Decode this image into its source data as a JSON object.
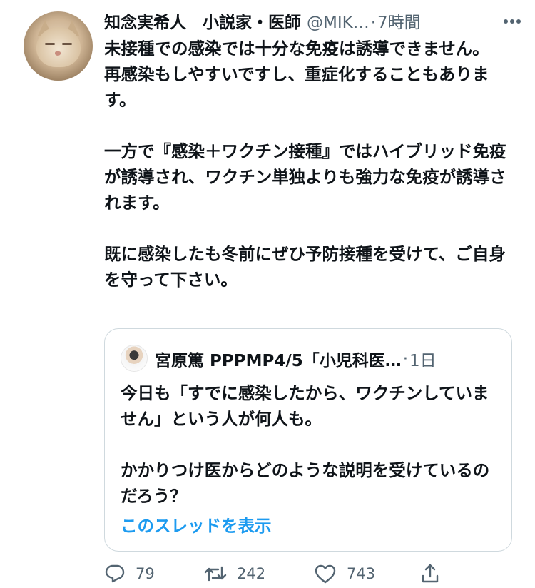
{
  "tweet": {
    "author_name": "知念実希人　小説家・医師",
    "author_handle": "@MIK…",
    "separator": "·",
    "time": "7時間",
    "text": "未接種での感染では十分な免疫は誘導できません。\n再感染もしやすいですし、重症化することもあります。\n\n一方で『感染＋ワクチン接種』ではハイブリッド免疫が誘導され、ワクチン単独よりも強力な免疫が誘導されます。\n\n既に感染したも冬前にぜひ予防接種を受けて、ご自身を守って下さい。"
  },
  "quote": {
    "author_name": "宮原篤 PPPMP4/5「小児科医…",
    "separator": "·",
    "time": "1日",
    "text": "今日も「すでに感染したから、ワクチンしていません」という人が何人も。\n\nかかりつけ医からどのような説明を受けているのだろう？",
    "show_thread": "このスレッドを表示"
  },
  "actions": {
    "reply_count": "79",
    "retweet_count": "242",
    "like_count": "743"
  },
  "colors": {
    "text": "#0f1419",
    "muted": "#536471",
    "link": "#1d9bf0",
    "border": "#cfd9de"
  },
  "icons": {
    "more": "more-icon",
    "reply": "reply-icon",
    "retweet": "retweet-icon",
    "like": "heart-icon",
    "share": "share-icon"
  }
}
